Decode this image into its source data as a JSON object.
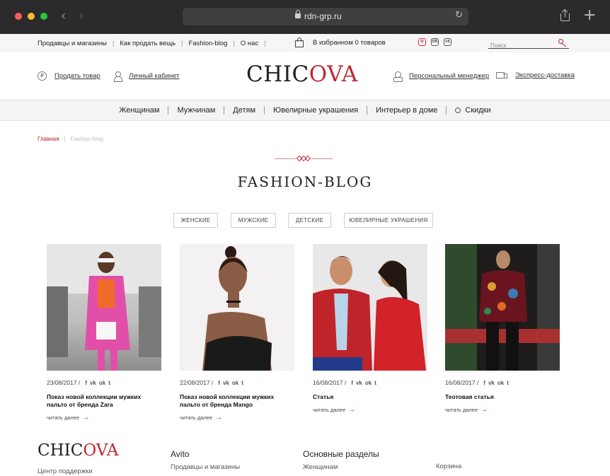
{
  "browser": {
    "url": "rdn-grp.ru"
  },
  "topbar": {
    "links": [
      "Продавцы и магазины",
      "Как продать вещь",
      "Fashion-blog",
      "О нас"
    ],
    "favorites": "В избранном 0 товаров",
    "search_placeholder": "Поиск",
    "social_icons": [
      "instagram-icon",
      "odnoklassniki-icon",
      "vk-icon"
    ]
  },
  "header": {
    "sell": "Продать товар",
    "account": "Личный кабинет",
    "logo_a": "CHIC",
    "logo_b": "OVA",
    "manager": "Персональный менеджер",
    "delivery": "Экспресс-доставка"
  },
  "nav": [
    "Женщинам",
    "Мужчинам",
    "Детям",
    "Ювелирные украшения",
    "Интерьер в доме",
    "Скидки"
  ],
  "breadcrumb": {
    "home": "Главная",
    "current": "Fashion-blog"
  },
  "page_title": "FASHION-BLOG",
  "filters": [
    "ЖЕНСКИЕ",
    "МУЖСКИЕ",
    "ДЕТСКИЕ",
    "ЮВЕЛИРНЫЕ УКРАШЕНИЯ"
  ],
  "cards": [
    {
      "date": "23/08/2017 /",
      "title": "Показ новой коллекции мужких пальто от бренда Zara",
      "more": "читать далее"
    },
    {
      "date": "22/08/2017 /",
      "title": "Показ новой коллекции мужких пальто от бренда Mango",
      "more": "читать далее"
    },
    {
      "date": "16/08/2017 /",
      "title": "Статья",
      "more": "читать далее"
    },
    {
      "date": "16/08/2017 /",
      "title": "Теотовая статья",
      "more": "читать далее"
    }
  ],
  "share_icons": [
    "f",
    "vk",
    "ok",
    "tw"
  ],
  "footer": {
    "logo_a": "CHIC",
    "logo_b": "OVA",
    "support": "Центр поддержки",
    "col2_head": "Avito",
    "col2_item": "Продавцы и магазины",
    "col3_head": "Основные разделы",
    "col3_item": "Женщинам",
    "col4_item": "Корзина"
  },
  "colors": {
    "accent": "#c0292e",
    "nav_bg": "#f4f4f4",
    "chrome": "#2b2b2d"
  }
}
